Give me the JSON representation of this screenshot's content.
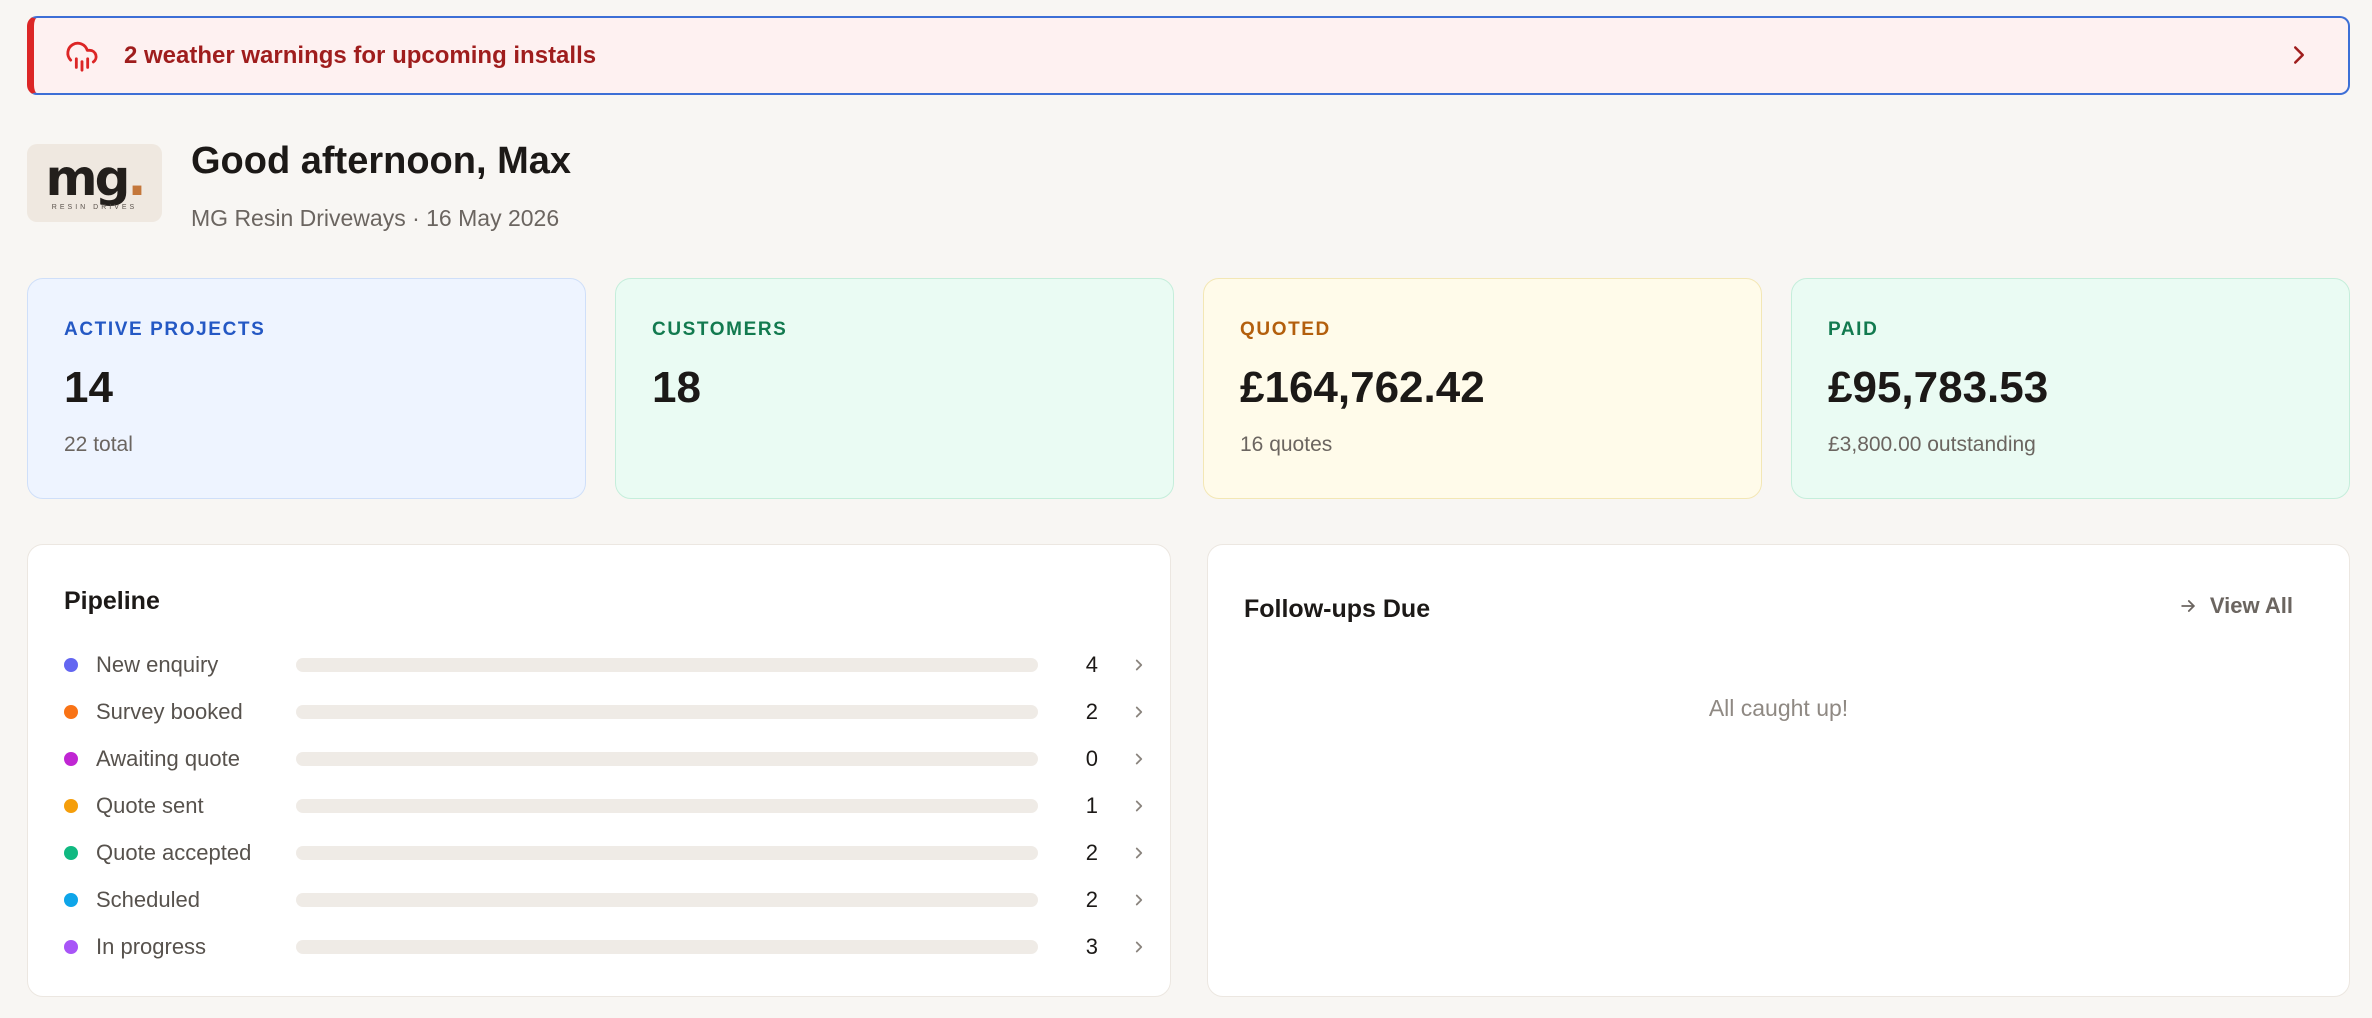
{
  "alert": {
    "text": "2 weather warnings for upcoming installs",
    "icon": "cloud-rain-icon",
    "colors": {
      "background": "#fef1f1",
      "accent": "#dc2626",
      "text": "#9f1d1d"
    }
  },
  "header": {
    "logo": {
      "mark": "mg",
      "tagline": "RESIN DRIVES"
    },
    "greeting": "Good afternoon, Max",
    "subtitle": "MG Resin Driveways · 16 May 2026"
  },
  "stats": [
    {
      "label": "ACTIVE PROJECTS",
      "value": "14",
      "sub": "22 total"
    },
    {
      "label": "CUSTOMERS",
      "value": "18",
      "sub": ""
    },
    {
      "label": "QUOTED",
      "value": "£164,762.42",
      "sub": "16 quotes"
    },
    {
      "label": "PAID",
      "value": "£95,783.53",
      "sub": "£3,800.00 outstanding"
    }
  ],
  "pipeline": {
    "title": "Pipeline",
    "max_count": 22,
    "stages": [
      {
        "label": "New enquiry",
        "count": 4,
        "color": "#6366f1"
      },
      {
        "label": "Survey booked",
        "count": 2,
        "color": "#f97316"
      },
      {
        "label": "Awaiting quote",
        "count": 0,
        "color": "#c026d3"
      },
      {
        "label": "Quote sent",
        "count": 1,
        "color": "#f59e0b"
      },
      {
        "label": "Quote accepted",
        "count": 2,
        "color": "#10b981"
      },
      {
        "label": "Scheduled",
        "count": 2,
        "color": "#0ea5e9"
      },
      {
        "label": "In progress",
        "count": 3,
        "color": "#a855f7"
      }
    ]
  },
  "followups": {
    "title": "Follow-ups Due",
    "view_all_label": "View All",
    "empty_text": "All caught up!"
  }
}
